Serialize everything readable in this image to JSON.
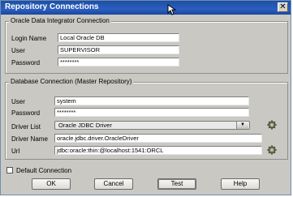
{
  "window": {
    "title": "Repository Connections",
    "close_glyph": "✕"
  },
  "odi": {
    "legend": "Oracle Data Integrator Connection",
    "login_name": {
      "label": "Login Name",
      "value": "Local Oracle DB"
    },
    "user": {
      "label": "User",
      "value": "SUPERVISOR"
    },
    "password": {
      "label": "Password",
      "value": "********"
    }
  },
  "db": {
    "legend": "Database Connection (Master Repository)",
    "user": {
      "label": "User",
      "value": "system"
    },
    "password": {
      "label": "Password",
      "value": "********"
    },
    "driver_list": {
      "label": "Driver List",
      "value": "Oracle JDBC Driver"
    },
    "driver_name": {
      "label": "Driver Name",
      "value": "oracle.jdbc.driver.OracleDriver"
    },
    "url": {
      "label": "Url",
      "value": "jdbc:oracle:thin:@localhost:1541:ORCL"
    }
  },
  "default_connection": {
    "label": "Default Connection",
    "checked": false
  },
  "buttons": {
    "ok": "OK",
    "cancel": "Cancel",
    "test": "Test",
    "help": "Help"
  },
  "icons": [
    "close-icon",
    "mouse-pointer-icon",
    "driver-browse-icon",
    "url-browse-icon",
    "dropdown-arrow-icon"
  ],
  "colors": {
    "titlebar": "#2c5fbf",
    "dialog_bg": "#c9c8c3"
  }
}
